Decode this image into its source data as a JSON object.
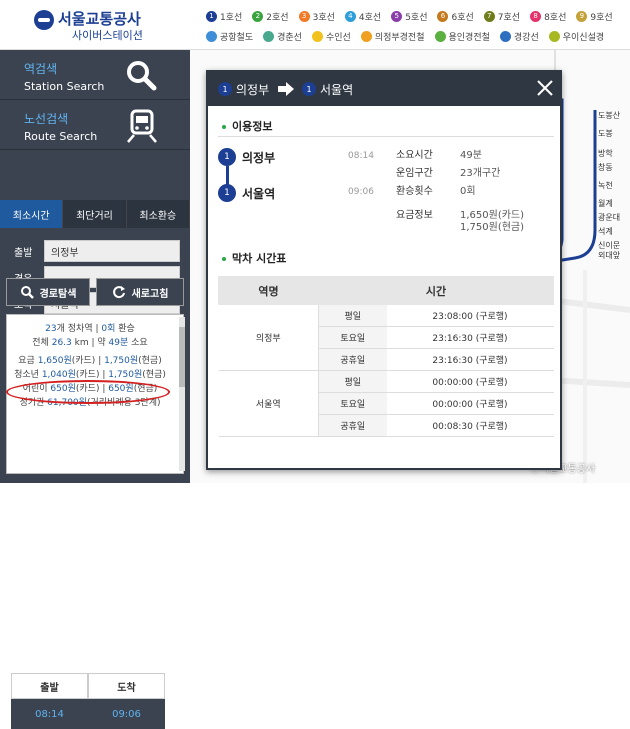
{
  "header": {
    "logo_title": "서울교통공사",
    "logo_subtitle": "사이버스테이션",
    "lines_row1": [
      {
        "num": "1",
        "label": "1호선",
        "color": "#1c3f94"
      },
      {
        "num": "2",
        "label": "2호선",
        "color": "#3aa340"
      },
      {
        "num": "3",
        "label": "3호선",
        "color": "#f07a26"
      },
      {
        "num": "4",
        "label": "4호선",
        "color": "#2d9ed8"
      },
      {
        "num": "5",
        "label": "5호선",
        "color": "#8a3fa8"
      },
      {
        "num": "6",
        "label": "6호선",
        "color": "#c47a1c"
      },
      {
        "num": "7",
        "label": "7호선",
        "color": "#6f7c1c"
      },
      {
        "num": "8",
        "label": "8호선",
        "color": "#e4336b"
      },
      {
        "num": "9",
        "label": "9호선",
        "color": "#c4a23a"
      }
    ],
    "lines_row2": [
      {
        "num": "",
        "label": "공항철도",
        "color": "#3f8ed8"
      },
      {
        "num": "",
        "label": "경춘선",
        "color": "#4aa88e"
      },
      {
        "num": "",
        "label": "수인선",
        "color": "#f2c21c"
      },
      {
        "num": "",
        "label": "의정부경전철",
        "color": "#f0a020"
      },
      {
        "num": "",
        "label": "용인경전철",
        "color": "#5ab040"
      },
      {
        "num": "",
        "label": "경강선",
        "color": "#2f6fc0"
      },
      {
        "num": "",
        "label": "우이신설경",
        "color": "#a8b820"
      }
    ]
  },
  "sidebar": {
    "station_search_ko": "역검색",
    "station_search_en": "Station Search",
    "route_search_ko": "노선검색",
    "route_search_en": "Route Search",
    "tabs": [
      "최소시간",
      "최단거리",
      "최소환승"
    ],
    "form": {
      "dep_label": "출발",
      "dep_value": "의정부",
      "via_label": "경유",
      "via_value": "",
      "arr_label": "도착",
      "arr_value": "서울역"
    },
    "search_button": "경로탐색",
    "refresh_button": "새로고침",
    "results": {
      "stops": "23",
      "stops_unit": "개 정차역",
      "transfers": "0회",
      "transfers_unit": "환승",
      "distance_prefix": "전체",
      "distance": "26.3",
      "distance_unit": "km",
      "approx": "약",
      "duration": "49분",
      "duration_unit": "소요",
      "fare_label": "요금",
      "fare_card": "1,650원",
      "fare_card_unit": "(카드)",
      "fare_cash": "1,750원",
      "fare_cash_unit": "(현금)",
      "youth_label": "청소년",
      "youth_card": "1,040원",
      "youth_cash": "1,750원",
      "child_label": "어린이",
      "child_card": "650원",
      "child_cash": "650원",
      "pass_label": "정기권",
      "pass_value": "61,700원",
      "pass_note": "(거리비례용 3단계)",
      "dep_header": "출발",
      "arr_header": "도착",
      "dep_time": "08:14",
      "arr_time": "09:06"
    }
  },
  "modal": {
    "from_num": "1",
    "from": "의정부",
    "to_num": "1",
    "to": "서울역",
    "info_title": "이용정보",
    "station1": "의정부",
    "time1": "08:14",
    "station2": "서울역",
    "time2": "09:06",
    "k_duration": "소요시간",
    "v_duration": "49분",
    "k_section": "운임구간",
    "v_section": "23개구간",
    "k_transfer": "환승횟수",
    "v_transfer": "0회",
    "k_fare": "요금정보",
    "v_fare1": "1,650원(카드)",
    "v_fare2": "1,750원(현금)",
    "timetable_title": "막차 시간표",
    "col_station": "역명",
    "col_time": "시간",
    "rows": [
      {
        "station": "의정부",
        "day": "평일",
        "time": "23:08:00 (구로행)"
      },
      {
        "station": "",
        "day": "토요일",
        "time": "23:16:30 (구로행)"
      },
      {
        "station": "",
        "day": "공휴일",
        "time": "23:16:30 (구로행)"
      },
      {
        "station": "서울역",
        "day": "평일",
        "time": "00:00:00 (구로행)"
      },
      {
        "station": "",
        "day": "토요일",
        "time": "00:00:00 (구로행)"
      },
      {
        "station": "",
        "day": "공휴일",
        "time": "00:08:30 (구로행)"
      }
    ]
  },
  "map": {
    "stations": [
      "도봉산",
      "도봉",
      "방학",
      "창동",
      "녹천",
      "월계",
      "광운대",
      "석계",
      "신이문",
      "외대앞"
    ],
    "copyright": "ⓒ서울교통공사"
  }
}
